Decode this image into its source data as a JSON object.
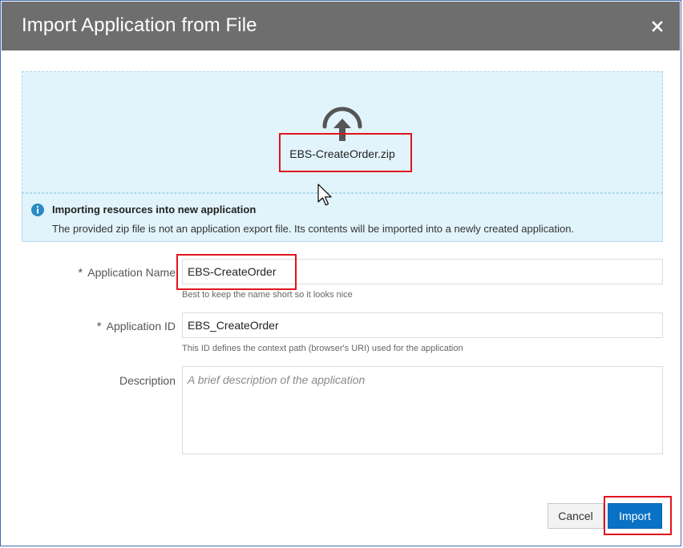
{
  "dialog": {
    "title": "Import Application from File",
    "close_icon": "close-icon"
  },
  "dropzone": {
    "icon": "upload-icon",
    "filename": "EBS-CreateOrder.zip"
  },
  "info": {
    "icon": "info-icon",
    "title": "Importing resources into new application",
    "text": "The provided zip file is not an application export file. Its contents will be imported into a newly created application."
  },
  "form": {
    "required_marker": "*",
    "name_label": "Application Name",
    "name_value": "EBS-CreateOrder",
    "name_hint": "Best to keep the name short so it looks nice",
    "id_label": "Application ID",
    "id_value": "EBS_CreateOrder",
    "id_hint": "This ID defines the context path (browser's URI) used for the application",
    "description_label": "Description",
    "description_placeholder": "A brief description of the application"
  },
  "buttons": {
    "cancel": "Cancel",
    "import": "Import"
  },
  "colors": {
    "header": "#6e6e6e",
    "dropzone_bg": "#e2f4fb",
    "primary": "#0a72c4",
    "highlight": "#e0141e",
    "info_icon": "#2b8bc7"
  }
}
